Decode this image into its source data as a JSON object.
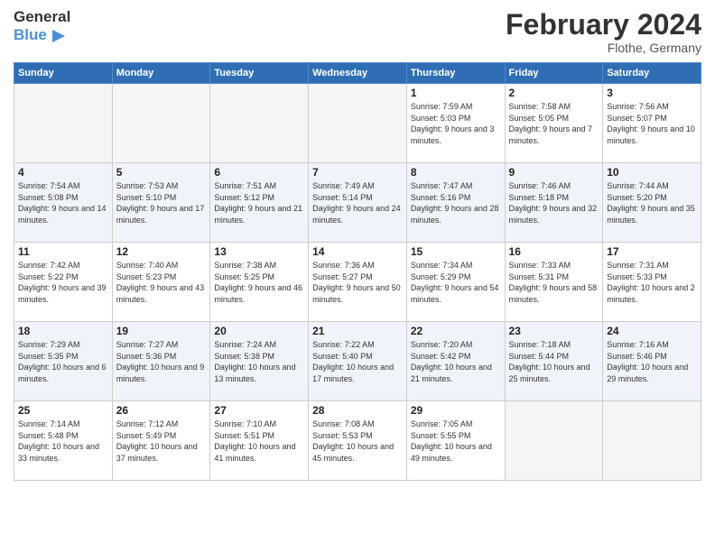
{
  "logo": {
    "general": "General",
    "blue": "Blue",
    "icon": "▶"
  },
  "header": {
    "month": "February 2024",
    "location": "Flothe, Germany"
  },
  "weekdays": [
    "Sunday",
    "Monday",
    "Tuesday",
    "Wednesday",
    "Thursday",
    "Friday",
    "Saturday"
  ],
  "weeks": [
    [
      {
        "day": "",
        "empty": true
      },
      {
        "day": "",
        "empty": true
      },
      {
        "day": "",
        "empty": true
      },
      {
        "day": "",
        "empty": true
      },
      {
        "day": "1",
        "sunrise": "7:59 AM",
        "sunset": "5:03 PM",
        "daylight": "9 hours and 3 minutes."
      },
      {
        "day": "2",
        "sunrise": "7:58 AM",
        "sunset": "5:05 PM",
        "daylight": "9 hours and 7 minutes."
      },
      {
        "day": "3",
        "sunrise": "7:56 AM",
        "sunset": "5:07 PM",
        "daylight": "9 hours and 10 minutes."
      }
    ],
    [
      {
        "day": "4",
        "sunrise": "7:54 AM",
        "sunset": "5:08 PM",
        "daylight": "9 hours and 14 minutes."
      },
      {
        "day": "5",
        "sunrise": "7:53 AM",
        "sunset": "5:10 PM",
        "daylight": "9 hours and 17 minutes."
      },
      {
        "day": "6",
        "sunrise": "7:51 AM",
        "sunset": "5:12 PM",
        "daylight": "9 hours and 21 minutes."
      },
      {
        "day": "7",
        "sunrise": "7:49 AM",
        "sunset": "5:14 PM",
        "daylight": "9 hours and 24 minutes."
      },
      {
        "day": "8",
        "sunrise": "7:47 AM",
        "sunset": "5:16 PM",
        "daylight": "9 hours and 28 minutes."
      },
      {
        "day": "9",
        "sunrise": "7:46 AM",
        "sunset": "5:18 PM",
        "daylight": "9 hours and 32 minutes."
      },
      {
        "day": "10",
        "sunrise": "7:44 AM",
        "sunset": "5:20 PM",
        "daylight": "9 hours and 35 minutes."
      }
    ],
    [
      {
        "day": "11",
        "sunrise": "7:42 AM",
        "sunset": "5:22 PM",
        "daylight": "9 hours and 39 minutes."
      },
      {
        "day": "12",
        "sunrise": "7:40 AM",
        "sunset": "5:23 PM",
        "daylight": "9 hours and 43 minutes."
      },
      {
        "day": "13",
        "sunrise": "7:38 AM",
        "sunset": "5:25 PM",
        "daylight": "9 hours and 46 minutes."
      },
      {
        "day": "14",
        "sunrise": "7:36 AM",
        "sunset": "5:27 PM",
        "daylight": "9 hours and 50 minutes."
      },
      {
        "day": "15",
        "sunrise": "7:34 AM",
        "sunset": "5:29 PM",
        "daylight": "9 hours and 54 minutes."
      },
      {
        "day": "16",
        "sunrise": "7:33 AM",
        "sunset": "5:31 PM",
        "daylight": "9 hours and 58 minutes."
      },
      {
        "day": "17",
        "sunrise": "7:31 AM",
        "sunset": "5:33 PM",
        "daylight": "10 hours and 2 minutes."
      }
    ],
    [
      {
        "day": "18",
        "sunrise": "7:29 AM",
        "sunset": "5:35 PM",
        "daylight": "10 hours and 6 minutes."
      },
      {
        "day": "19",
        "sunrise": "7:27 AM",
        "sunset": "5:36 PM",
        "daylight": "10 hours and 9 minutes."
      },
      {
        "day": "20",
        "sunrise": "7:24 AM",
        "sunset": "5:38 PM",
        "daylight": "10 hours and 13 minutes."
      },
      {
        "day": "21",
        "sunrise": "7:22 AM",
        "sunset": "5:40 PM",
        "daylight": "10 hours and 17 minutes."
      },
      {
        "day": "22",
        "sunrise": "7:20 AM",
        "sunset": "5:42 PM",
        "daylight": "10 hours and 21 minutes."
      },
      {
        "day": "23",
        "sunrise": "7:18 AM",
        "sunset": "5:44 PM",
        "daylight": "10 hours and 25 minutes."
      },
      {
        "day": "24",
        "sunrise": "7:16 AM",
        "sunset": "5:46 PM",
        "daylight": "10 hours and 29 minutes."
      }
    ],
    [
      {
        "day": "25",
        "sunrise": "7:14 AM",
        "sunset": "5:48 PM",
        "daylight": "10 hours and 33 minutes."
      },
      {
        "day": "26",
        "sunrise": "7:12 AM",
        "sunset": "5:49 PM",
        "daylight": "10 hours and 37 minutes."
      },
      {
        "day": "27",
        "sunrise": "7:10 AM",
        "sunset": "5:51 PM",
        "daylight": "10 hours and 41 minutes."
      },
      {
        "day": "28",
        "sunrise": "7:08 AM",
        "sunset": "5:53 PM",
        "daylight": "10 hours and 45 minutes."
      },
      {
        "day": "29",
        "sunrise": "7:05 AM",
        "sunset": "5:55 PM",
        "daylight": "10 hours and 49 minutes."
      },
      {
        "day": "",
        "empty": true
      },
      {
        "day": "",
        "empty": true
      }
    ]
  ]
}
